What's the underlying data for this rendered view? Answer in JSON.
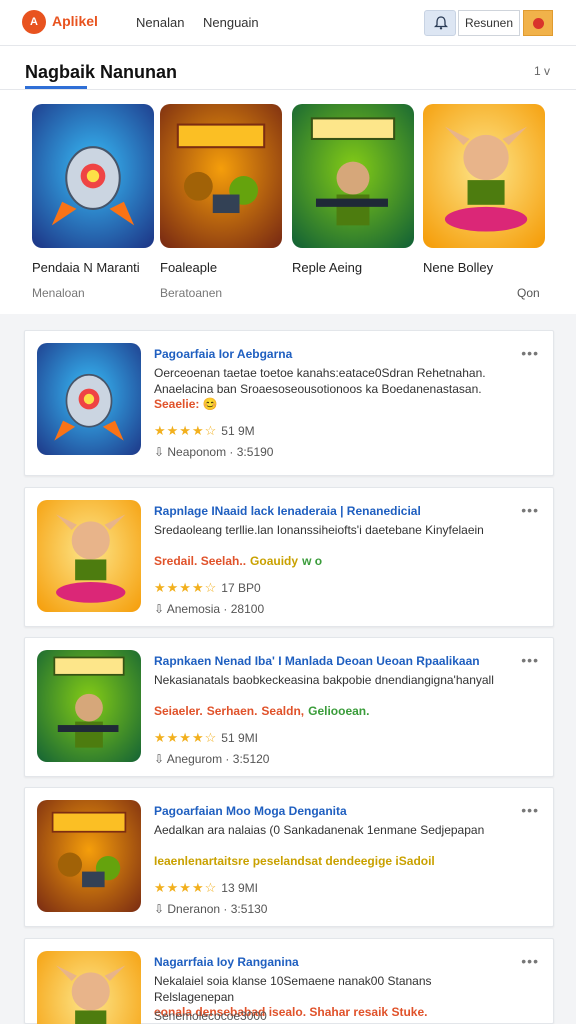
{
  "header": {
    "logo_text": "A",
    "brand": "Aplikel",
    "nav": [
      "Nenalan",
      "Nenguain"
    ],
    "login_label": "Resunen",
    "bell_icon": "bell-icon",
    "flag_icon": "language-flag-icon"
  },
  "section": {
    "title": "Nagbaik Nanunan",
    "more": "1 v",
    "featured": [
      {
        "label": "Pendaia N Maranti",
        "art": "rocket"
      },
      {
        "label": "Foaleaple",
        "art": "army"
      },
      {
        "label": "Reple Aeing",
        "art": "soldiers"
      },
      {
        "label": "Nene Bolley",
        "art": "elf"
      }
    ],
    "sub_left": "Menaloan",
    "sub_mid": "Beratoanen",
    "sub_right": "Qon"
  },
  "cards": [
    {
      "title": "Pagoarfaia Ior Aebgarna",
      "desc": "Oerceoenan taetae toetoe kanahs:eatace0Sdran Rehetnahan. Anaelacina ban Sroaesoseousotionoos ka Boedanenastasan.",
      "tags": [
        {
          "text": "Seaelie: 😊",
          "color": "#e0522a"
        }
      ],
      "stars": "★★★★☆",
      "rating": "51 9M",
      "meta": "Neaponom · 3:5190",
      "art": "rocket"
    },
    {
      "title": "Rapnlage INaaid lack Ienaderaia | Renanedicial",
      "desc": "Sredaoleang terllie.lan Ionanssiheiofts'i daetebane Kinyfelaein",
      "tags": [
        {
          "text": "Sredail. Seelah..",
          "color": "#e0522a"
        },
        {
          "text": "Goauidy",
          "color": "#c9a100"
        },
        {
          "text": "w o",
          "color": "#3a9c3a"
        }
      ],
      "stars": "★★★★☆",
      "rating": "17 BP0",
      "meta": "Anemosia · 28100",
      "art": "elf"
    },
    {
      "title": "Rapnkaen Nenad Iba' I Manlada Deoan Ueoan Rpaalikaan",
      "desc": "Nekasianatals baobkeckeasina bakpobie dnendiangigna'hanyall",
      "tags": [
        {
          "text": "Seiaeler.",
          "color": "#e0522a"
        },
        {
          "text": "Serhaen.",
          "color": "#e0522a"
        },
        {
          "text": "Sealdn,",
          "color": "#e0522a"
        },
        {
          "text": "Geliooean.",
          "color": "#3a9c3a"
        }
      ],
      "stars": "★★★★☆",
      "rating": "51 9MI",
      "meta": "Anegurom · 3:5120",
      "art": "soldiers"
    },
    {
      "title": "Pagoarfaian Moo Moga Denganita",
      "desc": "Aedalkan ara nalaias (0 Sankadanenak 1enmane Sedjepapan",
      "tags": [
        {
          "text": "Ieaenlenartaitsre peselandsat dendeegige iSadoil",
          "color": "#c9a100"
        }
      ],
      "stars": "★★★★☆",
      "rating": "13 9MI",
      "meta": "Dneranon · 3:5130",
      "art": "army"
    },
    {
      "title": "Nagarrfaia Ioy Ranganina",
      "desc": "Nekalaiel soia klanse 10Semaene nanak00 Stanans Relslagenepan",
      "tags": [
        {
          "text": "eonala densebabad isealo. Shahar resaik Stuke.",
          "color": "#e0522a"
        }
      ],
      "stars": "",
      "rating": "",
      "meta": "Senemolecocoe3000",
      "art": "elf"
    }
  ],
  "colors": {
    "accent": "#2f6fd6",
    "brand": "#e8531f",
    "card_title": "#1f5fc0",
    "star": "#f2b01e"
  }
}
